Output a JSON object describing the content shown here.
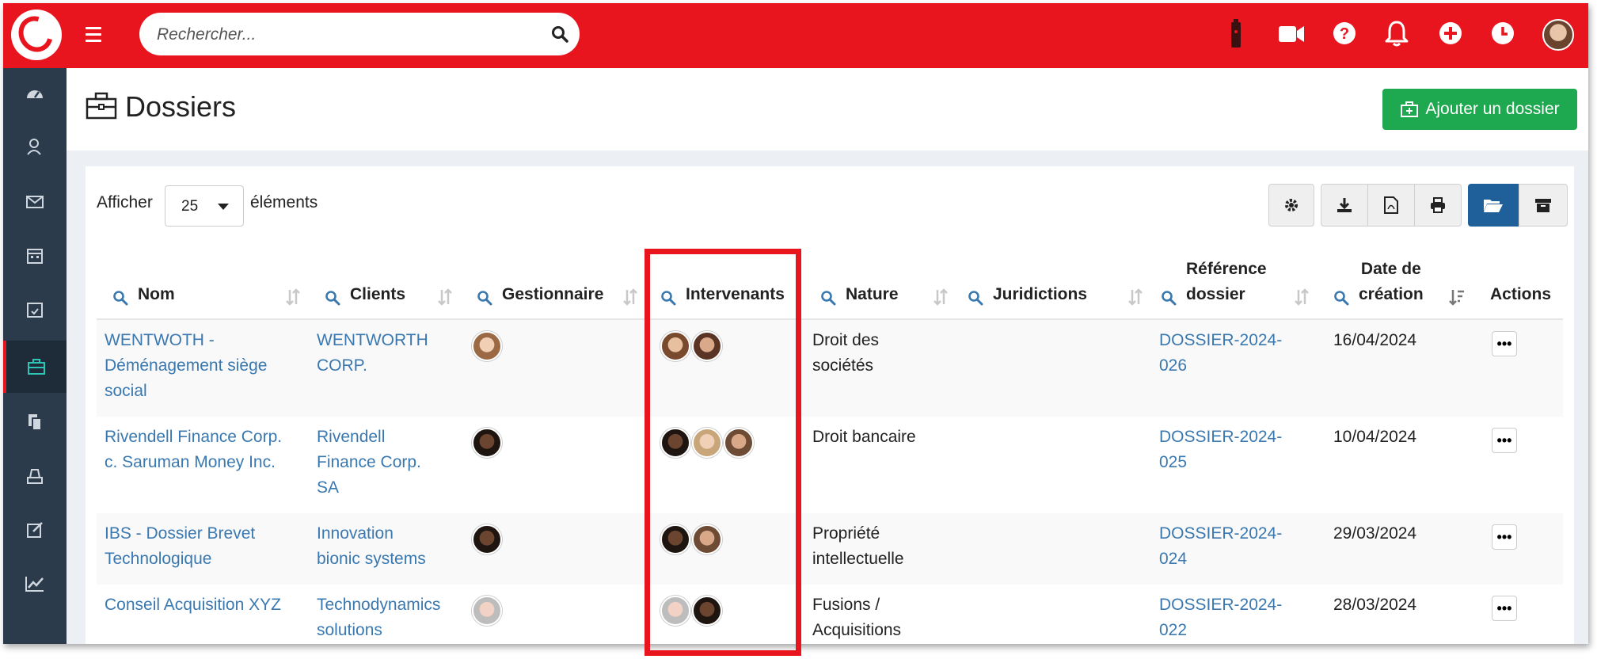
{
  "search": {
    "placeholder": "Rechercher..."
  },
  "page": {
    "title": "Dossiers",
    "add_button": "Ajouter un dossier"
  },
  "toolbar": {
    "show_label": "Afficher",
    "page_size": "25",
    "elements_label": "éléments"
  },
  "colors": {
    "brand_red": "#e8141e",
    "sidebar": "#2b3b4c",
    "add_green": "#1ea84f",
    "link_blue": "#3a78b0",
    "active_teal": "#2ec4b6"
  },
  "columns": {
    "nom": "Nom",
    "clients": "Clients",
    "gestionnaire": "Gestionnaire",
    "intervenants": "Intervenants",
    "nature": "Nature",
    "juridictions": "Juridictions",
    "reference_1": "Référence",
    "reference_2": "dossier",
    "date_1": "Date de",
    "date_2": "création",
    "actions": "Actions"
  },
  "rows": [
    {
      "nom_lines": [
        "WENTWOTH -",
        "Déménagement siège",
        "social"
      ],
      "client_lines": [
        "WENTWORTH",
        "CORP."
      ],
      "nature_lines": [
        "Droit des",
        "sociétés"
      ],
      "ref_lines": [
        "DOSSIER-2024-",
        "026"
      ],
      "date": "16/04/2024",
      "actions": "•••"
    },
    {
      "nom_lines": [
        "Rivendell Finance Corp.",
        "c. Saruman Money Inc."
      ],
      "client_lines": [
        "Rivendell",
        "Finance Corp.",
        "SA"
      ],
      "nature_lines": [
        "Droit bancaire"
      ],
      "ref_lines": [
        "DOSSIER-2024-",
        "025"
      ],
      "date": "10/04/2024",
      "actions": "•••"
    },
    {
      "nom_lines": [
        "IBS - Dossier Brevet",
        "Technologique"
      ],
      "client_lines": [
        "Innovation",
        "bionic systems"
      ],
      "nature_lines": [
        "Propriété",
        "intellectuelle"
      ],
      "ref_lines": [
        "DOSSIER-2024-",
        "024"
      ],
      "date": "29/03/2024",
      "actions": "•••"
    },
    {
      "nom_lines": [
        "Conseil Acquisition XYZ"
      ],
      "client_lines": [
        "Technodynamics",
        "solutions"
      ],
      "nature_lines": [
        "Fusions /",
        "Acquisitions"
      ],
      "ref_lines": [
        "DOSSIER-2024-",
        "022"
      ],
      "date": "28/03/2024",
      "actions": "•••"
    }
  ]
}
